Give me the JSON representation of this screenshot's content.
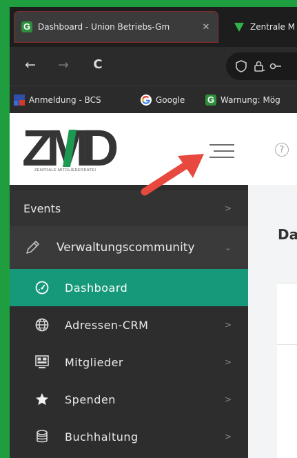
{
  "browser": {
    "tabs": [
      {
        "title": "Dashboard - Union Betriebs-Gm",
        "close": "✕",
        "favicon": "G",
        "active": true
      },
      {
        "title": "Zentrale M",
        "favicon": "triangle",
        "active": false
      }
    ],
    "nav": {
      "back": "←",
      "forward": "→",
      "reload": "C"
    },
    "bookmarks": [
      {
        "label": "Anmeldung - BCS"
      },
      {
        "label": "Google",
        "favicon": "G"
      },
      {
        "label": "Warnung: Mög",
        "favicon": "G"
      }
    ]
  },
  "header": {
    "logo_text": "ZMD",
    "logo_tagline": "ZENTRALE MITGLIEDERDATEI",
    "help": "?"
  },
  "sidebar": {
    "events": {
      "label": "Events",
      "chevron": ">"
    },
    "community": {
      "label": "Verwaltungscommunity",
      "chevron": "⌄"
    },
    "items": [
      {
        "label": "Dashboard",
        "icon": "dashboard-gauge-icon",
        "active": true
      },
      {
        "label": "Adressen-CRM",
        "icon": "globe-icon",
        "chevron": ">"
      },
      {
        "label": "Mitglieder",
        "icon": "members-icon",
        "chevron": ">"
      },
      {
        "label": "Spenden",
        "icon": "star-icon",
        "chevron": ">"
      },
      {
        "label": "Buchhaltung",
        "icon": "coins-icon",
        "chevron": ">"
      }
    ]
  },
  "main": {
    "title": "Da"
  },
  "colors": {
    "accent": "#16987a",
    "sidebar": "#2d2d2d",
    "arrow": "#e8493f",
    "desktop": "#1e9e3e"
  }
}
